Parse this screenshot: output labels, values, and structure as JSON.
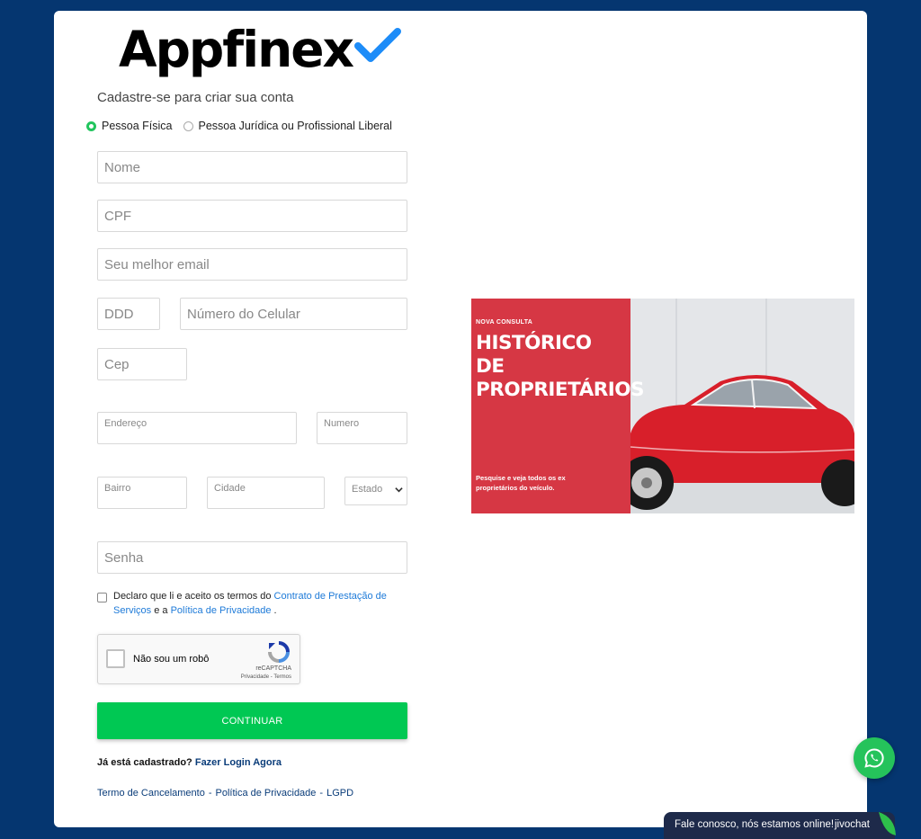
{
  "brand": {
    "name": "Appfinex",
    "accent": "#1d8cf8"
  },
  "form": {
    "subtitle": "Cadastre-se para criar sua conta",
    "person_types": [
      {
        "label": "Pessoa Física",
        "selected": true
      },
      {
        "label": "Pessoa Jurídica ou Profissional Liberal",
        "selected": false
      }
    ],
    "placeholders": {
      "nome": "Nome",
      "cpf": "CPF",
      "email": "Seu melhor email",
      "ddd": "DDD",
      "celular": "Número do Celular",
      "cep": "Cep",
      "endereco": "Endereço",
      "numero": "Numero",
      "bairro": "Bairro",
      "cidade": "Cidade",
      "estado": "Estado",
      "senha": "Senha"
    },
    "terms": {
      "prefix": "Declaro que li e aceito os termos do ",
      "contract_link": "Contrato de Prestação de Serviços",
      "middle": " e a ",
      "privacy_link": "Política de Privacidade",
      "suffix": " ."
    },
    "recaptcha": {
      "label": "Não sou um robô",
      "brand": "reCAPTCHA",
      "links": "Privacidade - Termos"
    },
    "continue_label": "CONTINUAR",
    "already_prefix": "Já está cadastrado?",
    "login_link": "Fazer Login Agora",
    "footer": {
      "cancel": "Termo de Cancelamento",
      "privacy": "Política de Privacidade",
      "lgpd": "LGPD"
    }
  },
  "banner": {
    "kicker": "NOVA CONSULTA",
    "title_line1": "HISTÓRICO",
    "title_line2": "DE",
    "title_line3": "PROPRIETÁRIOS",
    "description": "Pesquise e veja todos os ex proprietários do veículo.",
    "bg_color": "#d63744"
  },
  "chat": {
    "message": "Fale conosco, nós estamos online!",
    "brand": "jivochat"
  },
  "colors": {
    "page_bg": "#053670",
    "primary_button": "#00c853",
    "link": "#1d7ad8",
    "whatsapp": "#25c35b"
  }
}
